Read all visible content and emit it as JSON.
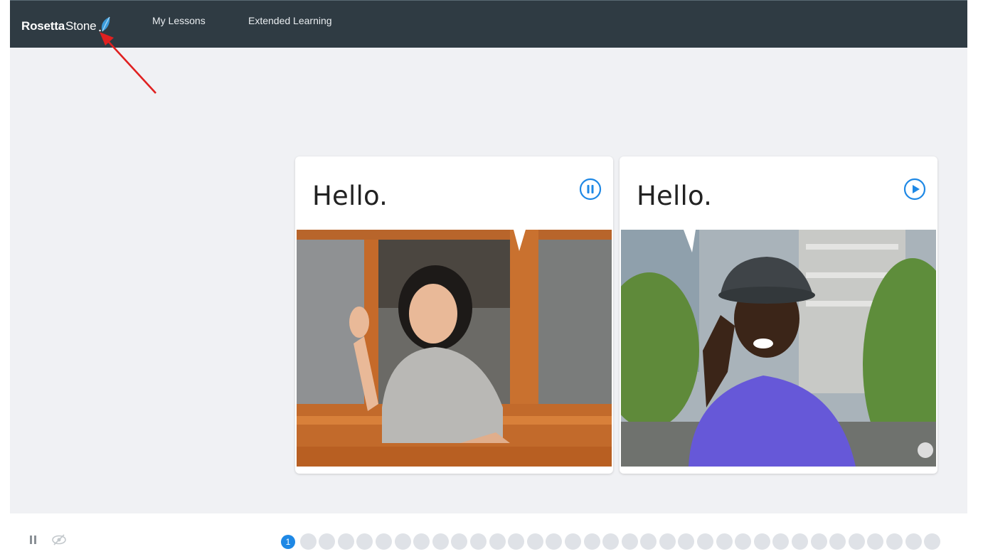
{
  "header": {
    "logo_bold": "Rosetta",
    "logo_light": "Stone",
    "logo_icon": "feather-leaf-icon",
    "nav": [
      "My Lessons",
      "Extended Learning"
    ]
  },
  "cards": [
    {
      "phrase": "Hello.",
      "audio_icon": "pause-icon",
      "image": "woman waving from window"
    },
    {
      "phrase": "Hello.",
      "audio_icon": "play-icon",
      "image": "man tipping hat"
    }
  ],
  "controls": {
    "pause_icon": "pause-icon",
    "hide_icon": "eye-slash-icon"
  },
  "progress": {
    "current": "1",
    "total": 35
  },
  "colors": {
    "topbar": "#2f3b43",
    "accent": "#1e88e5",
    "background": "#f0f1f4"
  }
}
